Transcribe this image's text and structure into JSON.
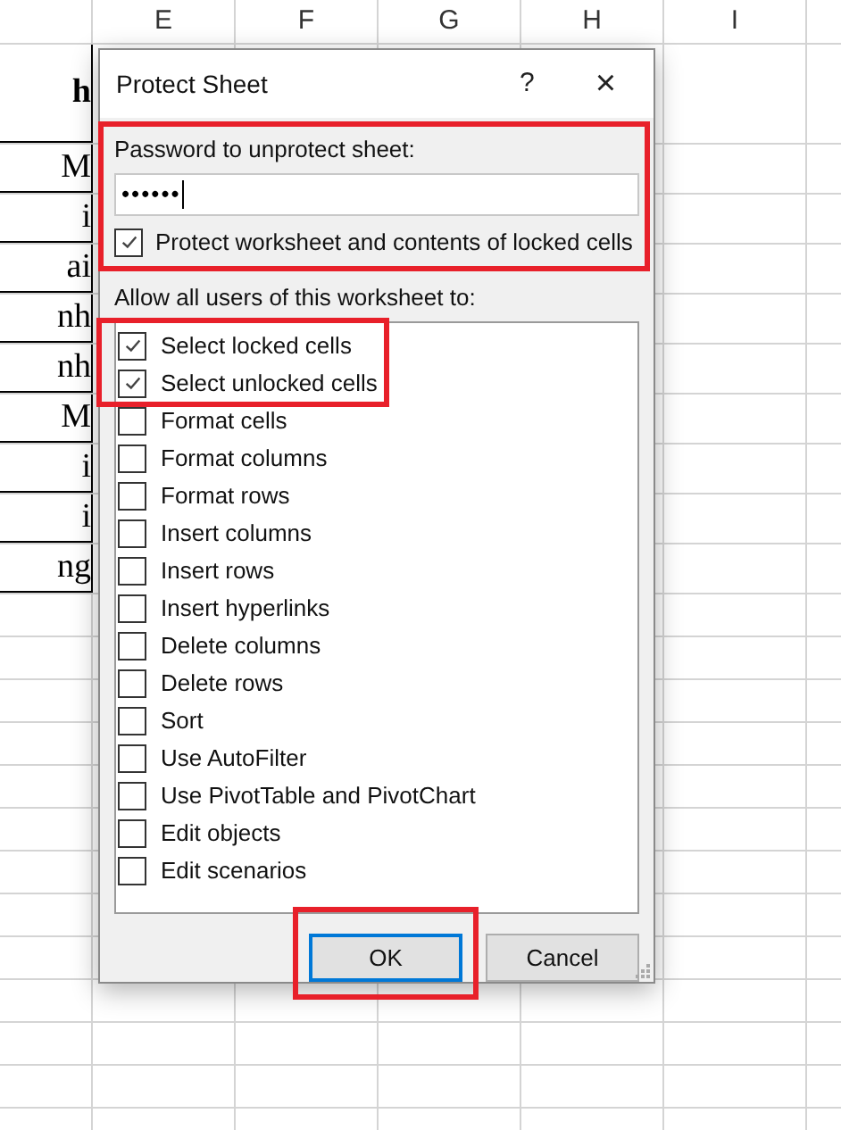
{
  "sheet": {
    "columns": [
      "E",
      "F",
      "G",
      "H",
      "I"
    ],
    "cut_column_cells": [
      "h",
      "M",
      "i",
      "ai",
      "nh",
      "nh",
      "M",
      "i",
      "i",
      "ng"
    ]
  },
  "dialog": {
    "title": "Protect Sheet",
    "help": "?",
    "close": "×",
    "password_section": {
      "highlighted": true,
      "label": "Password to unprotect sheet:",
      "value": "••••••",
      "protect_option": {
        "label": "Protect worksheet and contents of locked cells",
        "checked": true
      }
    },
    "permissions": {
      "label": "Allow all users of this worksheet to:",
      "items": [
        {
          "label": "Select locked cells",
          "checked": true,
          "highlighted": true
        },
        {
          "label": "Select unlocked cells",
          "checked": true,
          "highlighted": true
        },
        {
          "label": "Format cells",
          "checked": false,
          "highlighted": false
        },
        {
          "label": "Format columns",
          "checked": false,
          "highlighted": false
        },
        {
          "label": "Format rows",
          "checked": false,
          "highlighted": false
        },
        {
          "label": "Insert columns",
          "checked": false,
          "highlighted": false
        },
        {
          "label": "Insert rows",
          "checked": false,
          "highlighted": false
        },
        {
          "label": "Insert hyperlinks",
          "checked": false,
          "highlighted": false
        },
        {
          "label": "Delete columns",
          "checked": false,
          "highlighted": false
        },
        {
          "label": "Delete rows",
          "checked": false,
          "highlighted": false
        },
        {
          "label": "Sort",
          "checked": false,
          "highlighted": false
        },
        {
          "label": "Use AutoFilter",
          "checked": false,
          "highlighted": false
        },
        {
          "label": "Use PivotTable and PivotChart",
          "checked": false,
          "highlighted": false
        },
        {
          "label": "Edit objects",
          "checked": false,
          "highlighted": false
        },
        {
          "label": "Edit scenarios",
          "checked": false,
          "highlighted": false
        }
      ]
    },
    "buttons": [
      {
        "label": "OK",
        "kind": "default",
        "highlighted": true
      },
      {
        "label": "Cancel",
        "kind": "normal",
        "highlighted": false
      }
    ]
  }
}
